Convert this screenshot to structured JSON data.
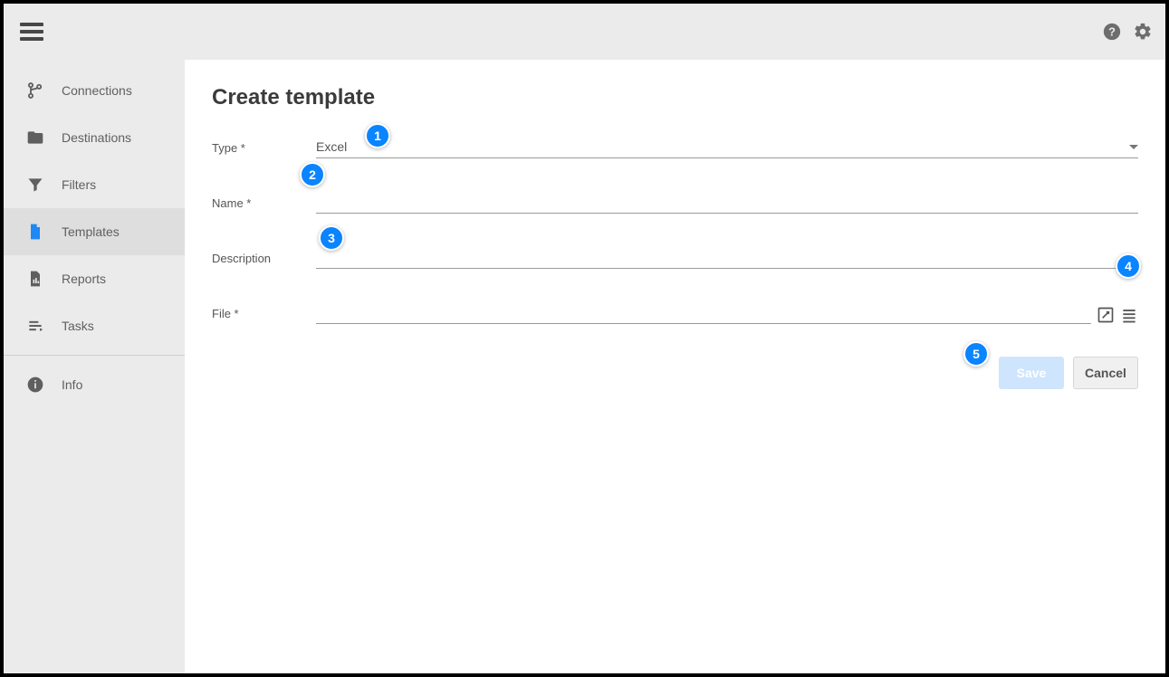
{
  "header": {
    "help_icon": "help-icon",
    "settings_icon": "gear-icon"
  },
  "sidebar": {
    "items": [
      {
        "label": "Connections",
        "icon": "git-branch-icon"
      },
      {
        "label": "Destinations",
        "icon": "folder-icon"
      },
      {
        "label": "Filters",
        "icon": "funnel-icon"
      },
      {
        "label": "Templates",
        "icon": "file-icon",
        "active": true
      },
      {
        "label": "Reports",
        "icon": "chart-file-icon"
      },
      {
        "label": "Tasks",
        "icon": "list-icon"
      }
    ],
    "info_label": "Info"
  },
  "page": {
    "title": "Create template",
    "fields": {
      "type_label": "Type *",
      "type_value": "Excel",
      "name_label": "Name *",
      "name_value": "",
      "description_label": "Description",
      "description_value": "",
      "file_label": "File *",
      "file_value": ""
    },
    "buttons": {
      "save": "Save",
      "cancel": "Cancel"
    }
  },
  "annotations": [
    "1",
    "2",
    "3",
    "4",
    "5"
  ]
}
